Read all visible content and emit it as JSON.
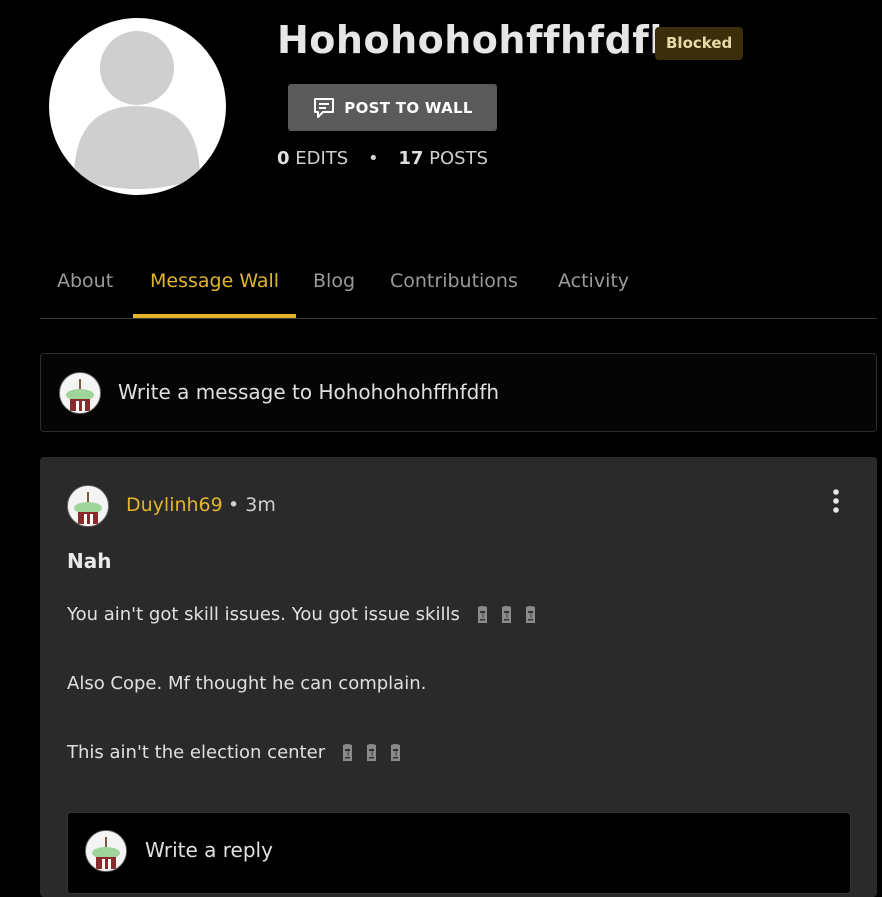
{
  "profile": {
    "username": "Hohohohohffhfdfh",
    "badge": "Blocked",
    "post_button_label": "POST TO WALL",
    "edits_count": "0",
    "edits_label": "EDITS",
    "posts_count": "17",
    "posts_label": "POSTS",
    "separator": "•"
  },
  "tabs": [
    {
      "label": "About"
    },
    {
      "label": "Message Wall"
    },
    {
      "label": "Blog"
    },
    {
      "label": "Contributions"
    },
    {
      "label": "Activity"
    }
  ],
  "active_tab": "Message Wall",
  "compose": {
    "placeholder": "Write a message to Hohohohohffhfdfh"
  },
  "post": {
    "author": "Duylinh69",
    "time": "• 3m",
    "title": "Nah",
    "lines": [
      "You ain't got skill issues. You got issue skills",
      "Also Cope. Mf thought he can complain.",
      "This ain't the election center"
    ],
    "emoji_name": "moai-icon",
    "reply_placeholder": "Write a reply"
  },
  "colors": {
    "accent": "#e2b52d",
    "card": "#2a2a2a",
    "background": "#000000"
  }
}
